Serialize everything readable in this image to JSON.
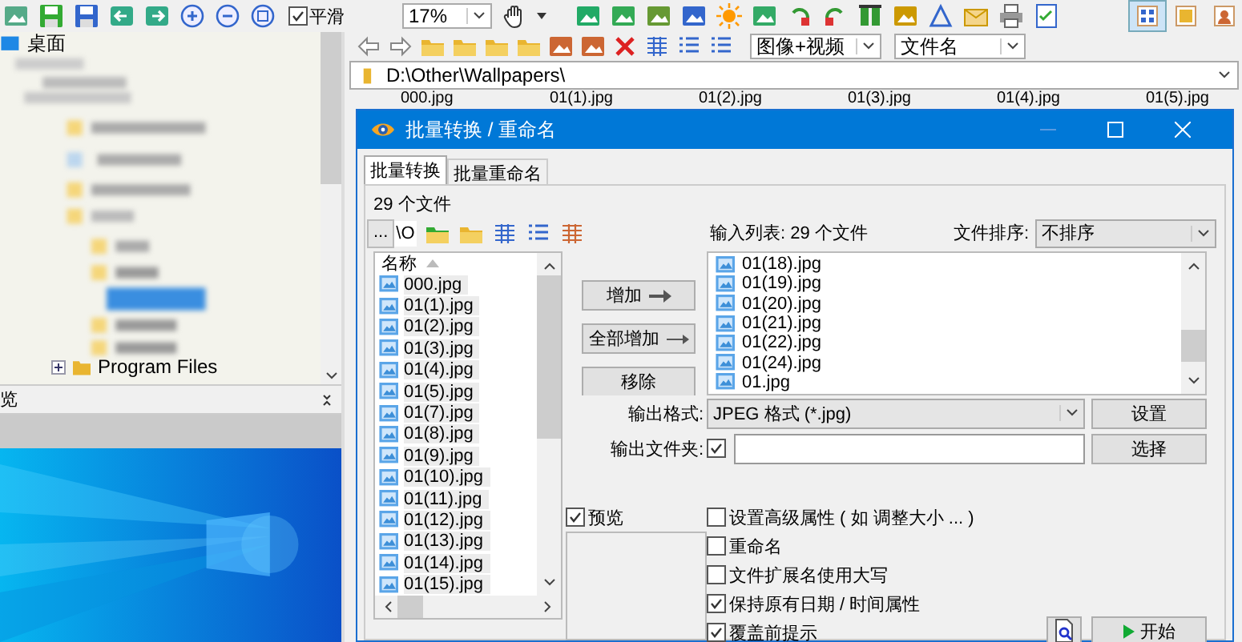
{
  "toolbar": {
    "smooth": {
      "label": "平滑",
      "checked": true
    },
    "zoom": "17%",
    "view_modes": [
      {
        "selected": true
      },
      {
        "selected": false
      },
      {
        "selected": false
      }
    ]
  },
  "nav": {
    "filter": "图像+视频",
    "sort": "文件名",
    "address": "D:\\Other\\Wallpapers\\"
  },
  "folder_tree": {
    "items": [
      {
        "label": "桌面"
      },
      {
        "label": "Program Files"
      }
    ]
  },
  "preview_pane": {
    "title": "览"
  },
  "thumbnails": [
    "000.jpg",
    "01(1).jpg",
    "01(2).jpg",
    "01(3).jpg",
    "01(4).jpg",
    "01(5).jpg"
  ],
  "dialog": {
    "title": "批量转换 / 重命名",
    "tabs": [
      {
        "label": "批量转换",
        "selected": true
      },
      {
        "label": "批量重命名",
        "selected": false
      }
    ],
    "file_count": "29 个文件",
    "path_button": "...",
    "path_value": "\\O",
    "source_list": {
      "header": "名称",
      "items": [
        {
          "name": "000.jpg",
          "selected": true
        },
        {
          "name": "01(1).jpg",
          "selected": true
        },
        {
          "name": "01(2).jpg",
          "selected": true
        },
        {
          "name": "01(3).jpg",
          "selected": true
        },
        {
          "name": "01(4).jpg",
          "selected": true
        },
        {
          "name": "01(5).jpg",
          "selected": true
        },
        {
          "name": "01(7).jpg",
          "selected": true
        },
        {
          "name": "01(8).jpg",
          "selected": true
        },
        {
          "name": "01(9).jpg",
          "selected": true
        },
        {
          "name": "01(10).jpg",
          "selected": true
        },
        {
          "name": "01(11).jpg",
          "selected": true
        },
        {
          "name": "01(12).jpg",
          "selected": true
        },
        {
          "name": "01(13).jpg",
          "selected": true
        },
        {
          "name": "01(14).jpg",
          "selected": true
        },
        {
          "name": "01(15).jpg",
          "selected": true
        }
      ]
    },
    "buttons": [
      "增加",
      "全部增加",
      "移除"
    ],
    "input_list": {
      "label": "输入列表: 29 个文件",
      "items": [
        "01(18).jpg",
        "01(19).jpg",
        "01(20).jpg",
        "01(21).jpg",
        "01(22).jpg",
        "01(24).jpg",
        "01.jpg"
      ]
    },
    "sort": {
      "label": "文件排序:",
      "value": "不排序"
    },
    "output_format": {
      "label": "输出格式:",
      "value": "JPEG 格式 (*.jpg)",
      "button": "设置"
    },
    "output_folder": {
      "label": "输出文件夹:",
      "checked": true,
      "button": "选择"
    },
    "preview": {
      "label": "预览",
      "checked": true
    },
    "options": [
      {
        "label": "设置高级属性 ( 如 调整大小 ... )",
        "checked": false
      },
      {
        "label": "重命名",
        "checked": false
      },
      {
        "label": "文件扩展名使用大写",
        "checked": false
      },
      {
        "label": "保持原有日期 / 时间属性",
        "checked": true
      },
      {
        "label": "覆盖前提示",
        "checked": true
      }
    ],
    "start": "开始"
  }
}
